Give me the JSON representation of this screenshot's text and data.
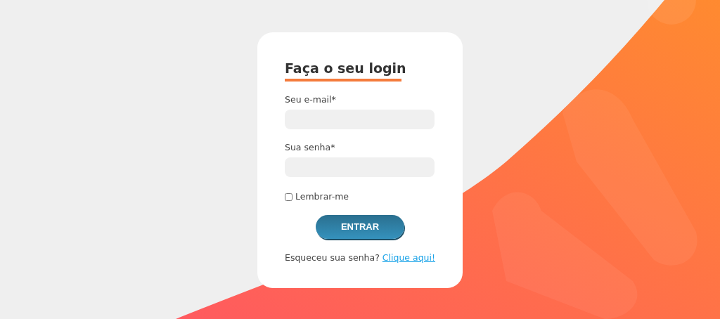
{
  "login": {
    "title": "Faça o seu login",
    "fields": [
      {
        "label": "Seu e-mail*"
      },
      {
        "label": "Sua senha*"
      }
    ],
    "remember": {
      "label": "Lembrar-me",
      "checked": false
    },
    "submit": "ENTRAR",
    "forgot": {
      "text": "Esqueceu sua senha?",
      "link": "Clique aqui!"
    }
  }
}
